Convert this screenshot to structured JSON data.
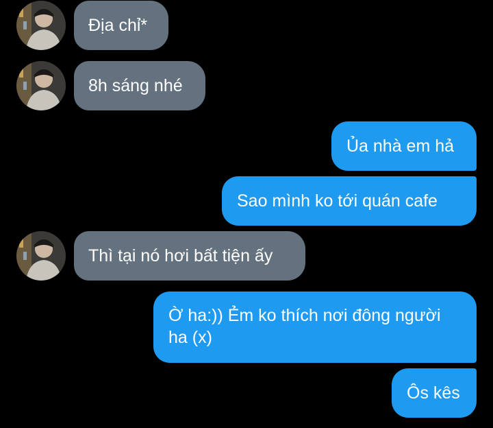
{
  "conversation": {
    "messages": [
      {
        "side": "incoming",
        "text": "Địa chỉ*"
      },
      {
        "side": "incoming",
        "text": "8h sáng nhé"
      },
      {
        "side": "outgoing",
        "text": "Ủa nhà em hả"
      },
      {
        "side": "outgoing",
        "text": "Sao mình ko tới quán cafe"
      },
      {
        "side": "incoming",
        "text": "Thì tại nó hơi bất tiện ấy"
      },
      {
        "side": "outgoing",
        "text": "Ờ ha:)) Ẻm ko thích nơi đông người ha (x)"
      },
      {
        "side": "outgoing",
        "text": "Ôs kês"
      }
    ]
  },
  "theme": {
    "background": "#000000",
    "incoming_bubble": "#64717f",
    "outgoing_bubble": "#1e9bf0",
    "text": "#ffffff"
  },
  "icons": {
    "avatar": "contact-avatar-icon"
  }
}
